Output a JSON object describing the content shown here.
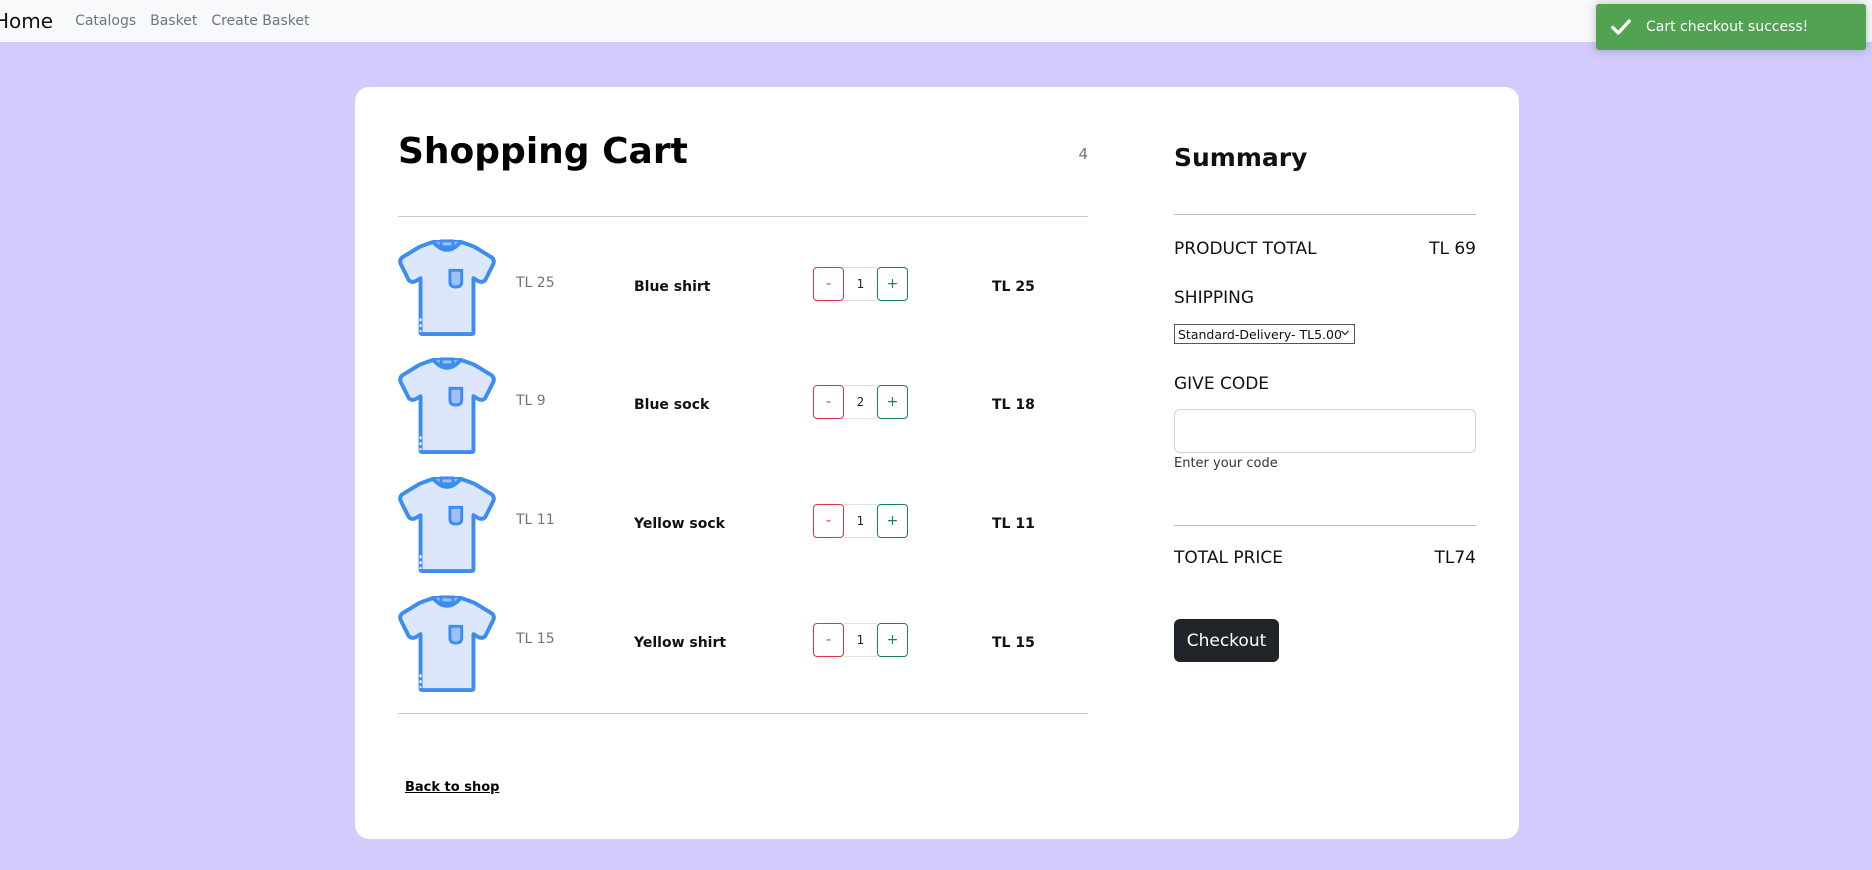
{
  "nav": {
    "brand": "Home",
    "links": [
      "Catalogs",
      "Basket",
      "Create Basket"
    ]
  },
  "toast": {
    "message": "Cart checkout success!",
    "icon": "check-icon",
    "color": "#51a351"
  },
  "cart": {
    "title": "Shopping Cart",
    "count": "4",
    "items": [
      {
        "unit_price": "TL 25",
        "name": "Blue shirt",
        "qty": "1",
        "total": "TL 25",
        "icon": "tshirt-icon"
      },
      {
        "unit_price": "TL 9",
        "name": "Blue sock",
        "qty": "2",
        "total": "TL 18",
        "icon": "tshirt-icon"
      },
      {
        "unit_price": "TL 11",
        "name": "Yellow sock",
        "qty": "1",
        "total": "TL 11",
        "icon": "tshirt-icon"
      },
      {
        "unit_price": "TL 15",
        "name": "Yellow shirt",
        "qty": "1",
        "total": "TL 15",
        "icon": "tshirt-icon"
      }
    ],
    "minus_label": "-",
    "plus_label": "+",
    "back_link": "Back to shop"
  },
  "summary": {
    "title": "Summary",
    "product_total_label": "PRODUCT TOTAL",
    "product_total_value": "TL 69",
    "shipping_label": "SHIPPING",
    "shipping_selected": "Standard-Delivery- TL5.00",
    "code_label": "GIVE CODE",
    "code_value": "",
    "code_help": "Enter your code",
    "total_label": "TOTAL PRICE",
    "total_value": "TL74",
    "checkout_label": "Checkout"
  },
  "colors": {
    "background": "#d2cbfc",
    "minus": "#dc3545",
    "plus": "#198754",
    "checkout": "#212529"
  }
}
